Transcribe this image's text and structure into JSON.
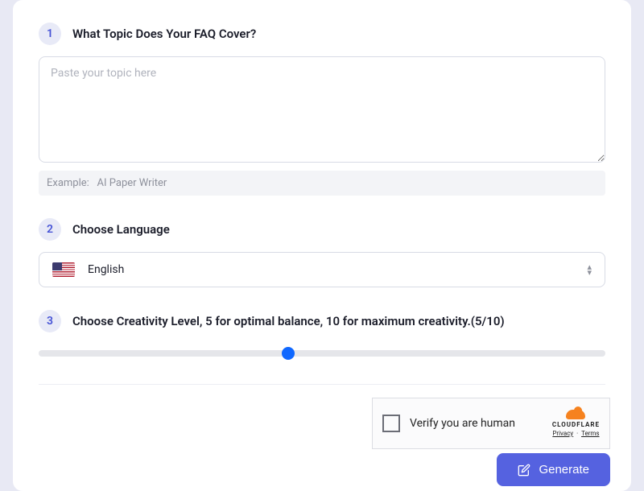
{
  "step1": {
    "num": "1",
    "title": "What Topic Does Your FAQ Cover?",
    "placeholder": "Paste your topic here",
    "example_label": "Example:",
    "example_value": "AI Paper Writer"
  },
  "step2": {
    "num": "2",
    "title": "Choose Language",
    "selected": "English"
  },
  "step3": {
    "num": "3",
    "title": "Choose Creativity Level, 5 for optimal balance, 10 for maximum creativity.(5/10)",
    "value": 5,
    "min": 0,
    "max": 10
  },
  "captcha": {
    "text": "Verify you are human",
    "brand": "CLOUDFLARE",
    "privacy": "Privacy",
    "terms": "Terms"
  },
  "generate": {
    "label": "Generate"
  }
}
